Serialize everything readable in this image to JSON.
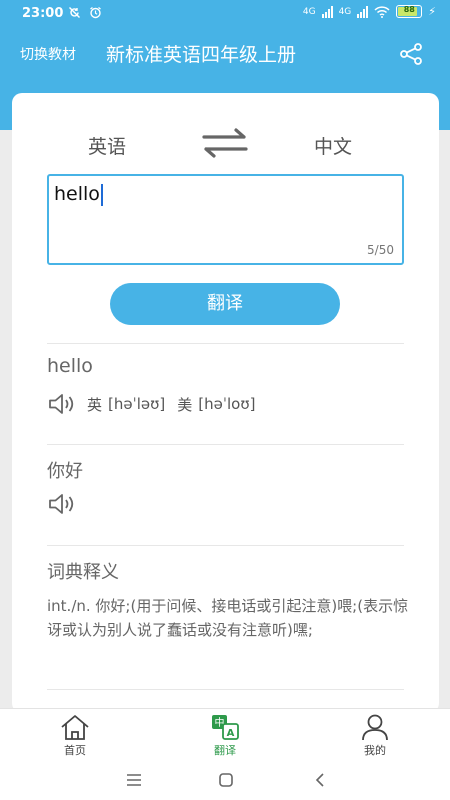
{
  "status_bar": {
    "time": "23:00",
    "left_icons": [
      "sync-off-icon",
      "alarm-icon"
    ],
    "network_1": "4G",
    "network_2": "4G",
    "battery": "88",
    "battery_level": 0.88
  },
  "header": {
    "switch_book_label": "切换教材",
    "title": "新标准英语四年级上册",
    "share_icon": "share-icon"
  },
  "translator": {
    "source_lang": "英语",
    "target_lang": "中文",
    "swap_icon": "swap-arrows-icon",
    "input_value": "hello",
    "char_count": "5/50",
    "translate_button": "翻译"
  },
  "result": {
    "word": "hello",
    "uk_label": "英",
    "uk_phonetic": "[həˈləʊ]",
    "us_label": "美",
    "us_phonetic": "[həˈloʊ]",
    "meaning": "你好",
    "dict_title": "词典释义",
    "dict_text": "int./n. 你好;(用于问候、接电话或引起注意)喂;(表示惊讶或认为别人说了蠢话或没有注意听)嘿;"
  },
  "bottom_nav": {
    "items": [
      {
        "label": "首页",
        "icon": "home-icon",
        "active": false
      },
      {
        "label": "翻译",
        "icon": "translate-icon",
        "active": true
      },
      {
        "label": "我的",
        "icon": "user-icon",
        "active": false
      }
    ]
  },
  "colors": {
    "accent": "#47b3e6",
    "active_tab": "#2e9a4b"
  }
}
